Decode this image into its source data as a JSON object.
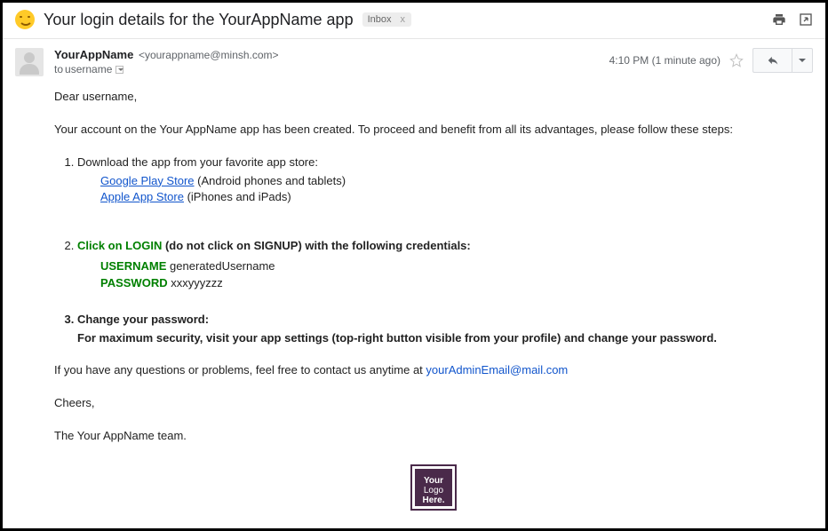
{
  "header": {
    "subject": "Your login details for the YourAppName app",
    "label": "Inbox"
  },
  "meta": {
    "from_name": "YourAppName",
    "from_email": "<yourappname@minsh.com>",
    "to_prefix": "to ",
    "to_name": "username",
    "time": "4:10 PM (1 minute ago)"
  },
  "body": {
    "greeting": "Dear username,",
    "intro_1": "Your account on the ",
    "intro_app": "Your AppName",
    "intro_2": " app has been created. To proceed and benefit from all its advantages, please follow these steps:",
    "step1_lead": "Download the app from your favorite app store:",
    "gplay": "Google Play Store",
    "gplay_note": " (Android phones and tablets)",
    "appstore": "Apple App Store",
    "appstore_note": " (iPhones and iPads)",
    "step2_click": "Click on LOGIN",
    "step2_rest": " (do not click on SIGNUP) with the following credentials:",
    "username_label": "USERNAME",
    "username_value": " generatedUsername",
    "password_label": "PASSWORD",
    "password_value": " xxxyyyzzz",
    "step3_title": "Change your password:",
    "step3_text": "For maximum security, visit your app settings (top-right button visible from your profile) and change your password.",
    "contact_1": "If you have any questions or problems, feel free to contact us anytime at ",
    "contact_email": "yourAdminEmail@mail.com",
    "cheers": "Cheers,",
    "signoff_1": "The ",
    "signoff_app": "Your AppName",
    "signoff_2": " team."
  },
  "logo": {
    "l1": "Your",
    "l2": "Logo",
    "l3": "Here."
  }
}
